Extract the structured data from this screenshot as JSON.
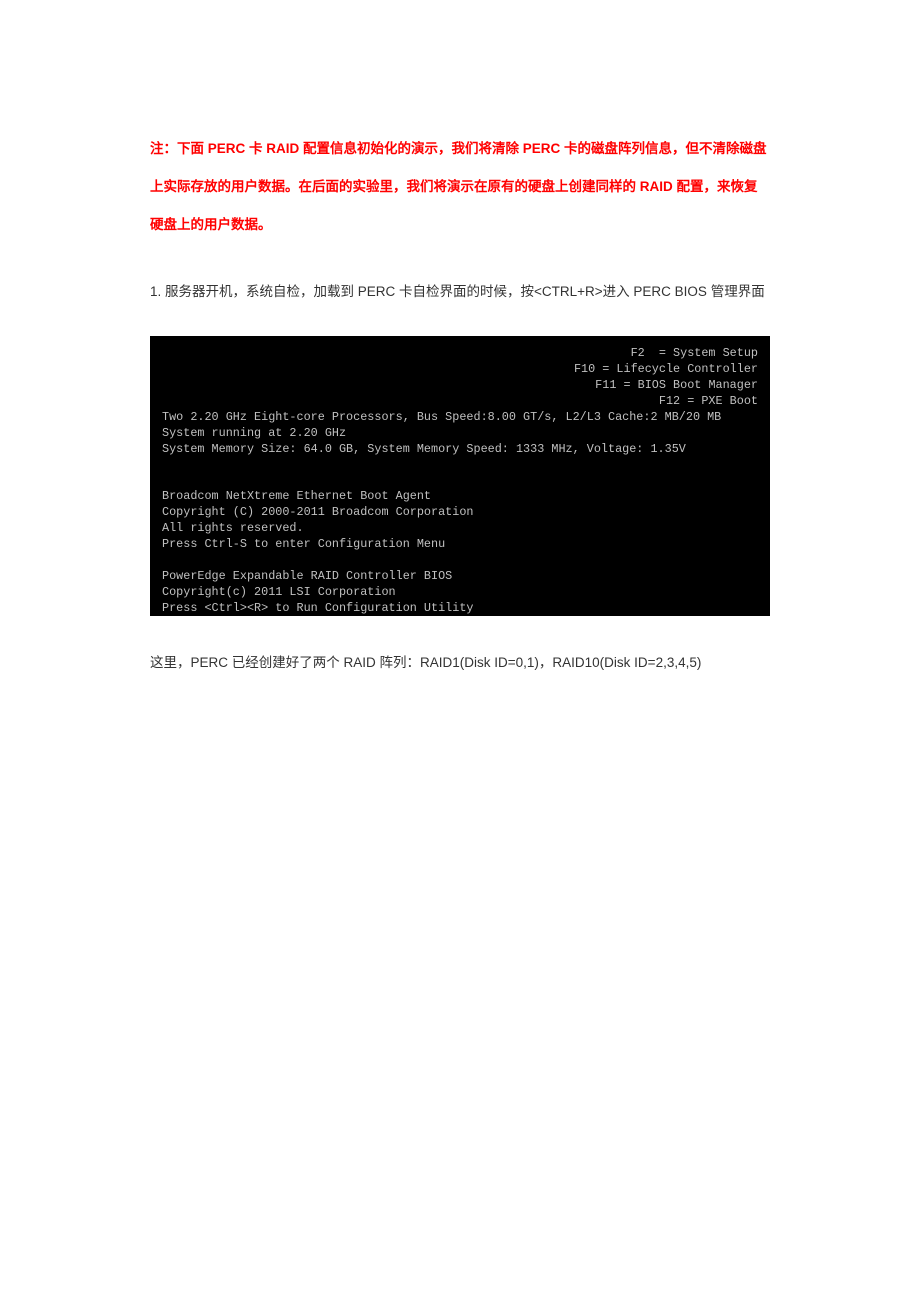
{
  "note": {
    "text": "注：下面 PERC 卡 RAID 配置信息初始化的演示，我们将清除 PERC 卡的磁盘阵列信息，但不清除磁盘上实际存放的用户数据。在后面的实验里，我们将演示在原有的硬盘上创建同样的 RAID 配置，来恢复硬盘上的用户数据。"
  },
  "step1": {
    "text": "1. 服务器开机，系统自检，加载到 PERC 卡自检界面的时候，按<CTRL+R>进入 PERC BIOS 管理界面"
  },
  "terminal": {
    "fkeys": {
      "f2": "F2  = System Setup",
      "f10": "F10 = Lifecycle Controller",
      "f11": "F11 = BIOS Boot Manager",
      "f12": "F12 = PXE Boot"
    },
    "sys": {
      "cpu": "Two 2.20 GHz Eight-core Processors, Bus Speed:8.00 GT/s, L2/L3 Cache:2 MB/20 MB",
      "running": "System running at 2.20 GHz",
      "mem": "System Memory Size: 64.0 GB, System Memory Speed: 1333 MHz, Voltage: 1.35V"
    },
    "nic": {
      "l1": "Broadcom NetXtreme Ethernet Boot Agent",
      "l2": "Copyright (C) 2000-2011 Broadcom Corporation",
      "l3": "All rights reserved.",
      "l4": "Press Ctrl-S to enter Configuration Menu"
    },
    "raid": {
      "l1": "PowerEdge Expandable RAID Controller BIOS",
      "l2": "Copyright(c) 2011 LSI Corporation",
      "l3": "Press <Ctrl><R> to Run Configuration Utility"
    },
    "cursor": "_"
  },
  "caption": {
    "text": "这里，PERC 已经创建好了两个 RAID 阵列：RAID1(Disk ID=0,1)，RAID10(Disk ID=2,3,4,5)"
  }
}
